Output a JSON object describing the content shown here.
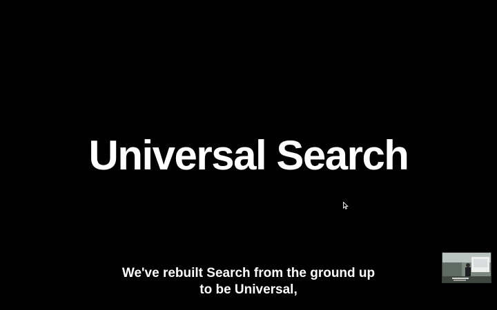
{
  "slide": {
    "title": "Universal Search"
  },
  "subtitles": {
    "line1": "We've rebuilt Search from the ground up",
    "line2": "to be Universal,"
  },
  "cursor": {
    "icon": "arrow-pointer-icon"
  },
  "pip": {
    "icon": "video-thumbnail"
  },
  "colors": {
    "background": "#000000",
    "text": "#ffffff"
  }
}
